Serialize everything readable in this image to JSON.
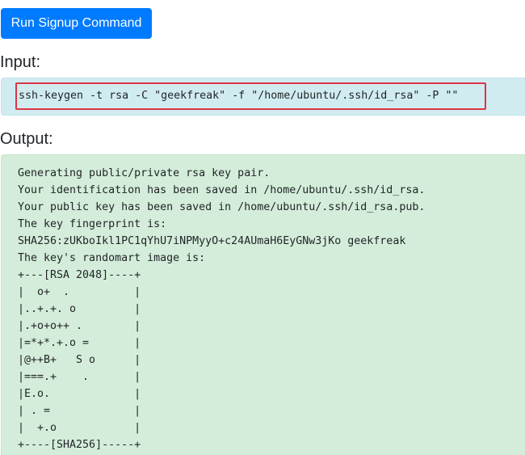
{
  "run_button": {
    "label": "Run Signup Command"
  },
  "input": {
    "label": "Input:",
    "command": "ssh-keygen -t rsa -C \"geekfreak\" -f \"/home/ubuntu/.ssh/id_rsa\" -P \"\""
  },
  "output": {
    "label": "Output:",
    "lines": [
      "Generating public/private rsa key pair.",
      "Your identification has been saved in /home/ubuntu/.ssh/id_rsa.",
      "Your public key has been saved in /home/ubuntu/.ssh/id_rsa.pub.",
      "The key fingerprint is:",
      "SHA256:zUKboIkl1PC1qYhU7iNPMyyO+c24AUmaH6EyGNw3jKo geekfreak",
      "The key's randomart image is:",
      "+---[RSA 2048]----+",
      "|  o+  .          |",
      "|..+.+. o         |",
      "|.+o+o++ .        |",
      "|=*+*.+.o =       |",
      "|@++B+   S o      |",
      "|===.+    .       |",
      "|E.o.             |",
      "| . =             |",
      "|  +.o            |",
      "+----[SHA256]-----+"
    ]
  },
  "colors": {
    "button_primary": "#007bff",
    "input_background": "#d1ecf1",
    "output_background": "#d4edda",
    "highlight_border": "#dc3545"
  }
}
